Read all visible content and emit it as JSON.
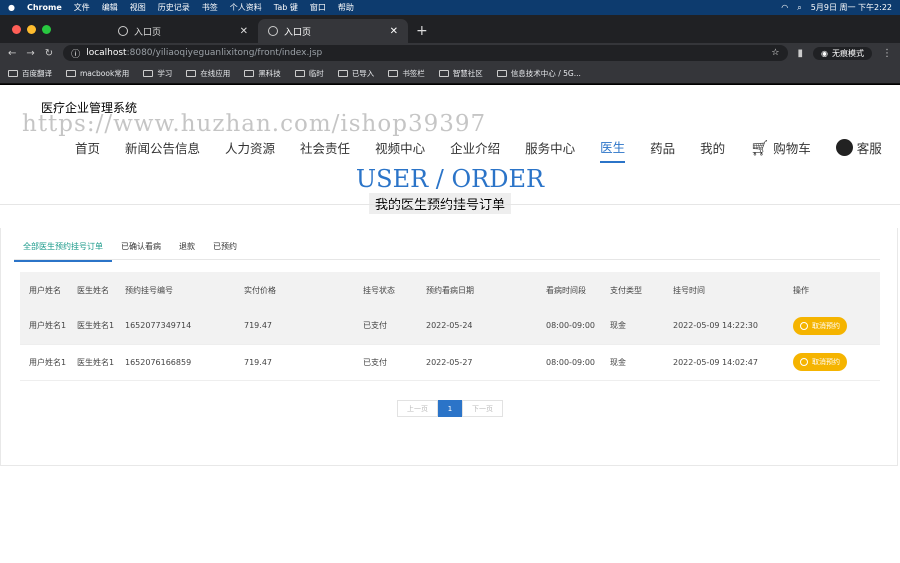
{
  "menubar": {
    "app": "Chrome",
    "items": [
      "文件",
      "编辑",
      "视图",
      "历史记录",
      "书签",
      "个人资料",
      "Tab 键",
      "窗口",
      "帮助"
    ],
    "clock": "5月9日 周一 下午2:22"
  },
  "tabs": [
    {
      "label": "入口页"
    },
    {
      "label": "入口页"
    }
  ],
  "address": {
    "host": "localhost",
    "path": ":8080/yiliaoqiyeguanlixitong/front/index.jsp",
    "incognito": "无痕模式"
  },
  "bookmarks": [
    "百度翻译",
    "macbook常用",
    "学习",
    "在线应用",
    "黑科技",
    "临时",
    "已导入",
    "书签栏",
    "智慧社区",
    "信息技术中心 / 5G..."
  ],
  "site": {
    "title": "医疗企业管理系统",
    "watermark": "https://www.huzhan.com/ishop39397"
  },
  "nav": {
    "items": [
      "首页",
      "新闻公告信息",
      "人力资源",
      "社会责任",
      "视频中心",
      "企业介绍",
      "服务中心",
      "医生",
      "药品",
      "我的"
    ],
    "active": "医生",
    "cart": "购物车",
    "service": "客服"
  },
  "hero": {
    "en": "USER / ORDER",
    "cn": "我的医生预约挂号订单"
  },
  "subtabs": [
    "全部医生预约挂号订单",
    "已确认看病",
    "退款",
    "已预约"
  ],
  "table": {
    "headers": [
      "用户姓名",
      "医生姓名",
      "预约挂号编号",
      "实付价格",
      "挂号状态",
      "预约看病日期",
      "看病时间段",
      "支付类型",
      "挂号时间",
      "操作"
    ],
    "rows": [
      {
        "user": "用户姓名1",
        "doctor": "医生姓名1",
        "no": "1652077349714",
        "price": "719.47",
        "status": "已支付",
        "date": "2022-05-24",
        "slot": "08:00-09:00",
        "pay": "现金",
        "time": "2022-05-09 14:22:30",
        "action": "取消预约"
      },
      {
        "user": "用户姓名1",
        "doctor": "医生姓名1",
        "no": "1652076166859",
        "price": "719.47",
        "status": "已支付",
        "date": "2022-05-27",
        "slot": "08:00-09:00",
        "pay": "现金",
        "time": "2022-05-09 14:02:47",
        "action": "取消预约"
      }
    ]
  },
  "pager": {
    "prev": "上一页",
    "current": "1",
    "next": "下一页"
  },
  "colors": {
    "accent": "#2b74c8",
    "button": "#f5b400",
    "menubar": "#0d3b6e"
  }
}
